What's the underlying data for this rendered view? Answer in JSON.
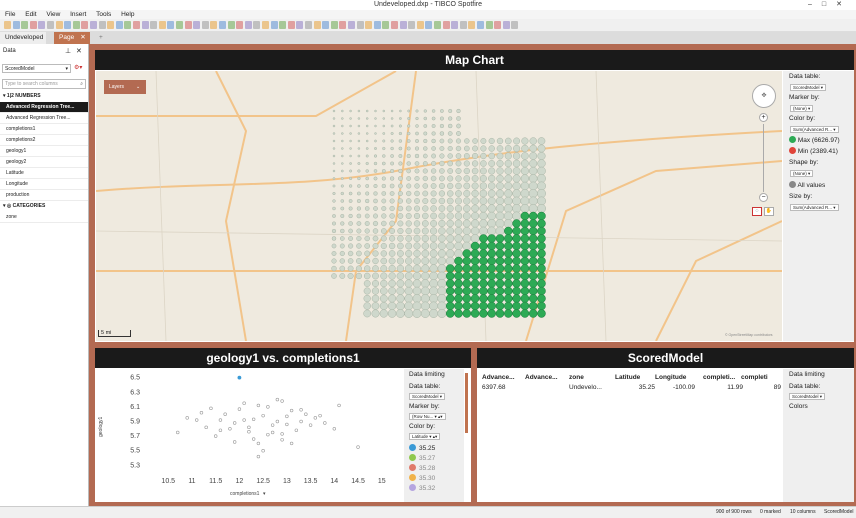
{
  "window": {
    "title": "Undeveloped.dxp - TIBCO Spotfire"
  },
  "menu": [
    "File",
    "Edit",
    "View",
    "Insert",
    "Tools",
    "Help"
  ],
  "tabs": {
    "first": "Undeveloped",
    "second": "Page"
  },
  "data_panel": {
    "title": "Data",
    "table": "ScoredModel",
    "search_placeholder": "Type to search columns",
    "numbers_header": "NUMBERS",
    "categories_header": "CATEGORIES",
    "columns": [
      "Advanced Regression Tree...",
      "Advanced Regression Tree...",
      "completions1",
      "completions2",
      "geology1",
      "geology2",
      "Latitude",
      "Longitude",
      "production"
    ],
    "categories": [
      "zone"
    ]
  },
  "map_chart": {
    "title": "Map Chart",
    "layers_button": "Layers",
    "scale": "5 mi",
    "attribution": "© OpenStreetMap contributors",
    "legend": {
      "data_table_label": "Data table:",
      "data_table": "ScoredModel",
      "marker_by_label": "Marker by:",
      "marker_by": "(None)",
      "color_by_label": "Color by:",
      "color_by": "Sum(Advanced R...",
      "max_label": "Max (6626.97)",
      "min_label": "Min (2389.41)",
      "shape_by_label": "Shape by:",
      "shape_by": "(None)",
      "all_values": "All values",
      "size_by_label": "Size by:",
      "size_by": "Sum(Advanced R...",
      "max_color": "#2daa55",
      "min_color": "#e0443a"
    }
  },
  "scatter": {
    "title": "geology1 vs. completions1",
    "legend": {
      "limiting": "Data limiting",
      "data_table_label": "Data table:",
      "data_table": "ScoredModel",
      "marker_by_label": "Marker by:",
      "marker_by": "(Row Nu...",
      "color_by_label": "Color by:",
      "color_by": "Latitude",
      "entries": [
        {
          "label": "35.25",
          "color": "#3a9ad6"
        },
        {
          "label": "35.27",
          "color": "#8fc84e"
        },
        {
          "label": "35.28",
          "color": "#e07a6a"
        },
        {
          "label": "35.30",
          "color": "#f0b24a"
        },
        {
          "label": "35.32",
          "color": "#b5a5e0"
        }
      ]
    }
  },
  "chart_data": [
    {
      "type": "scatter",
      "title": "geology1 vs. completions1",
      "xlabel": "completions1",
      "ylabel": "geology1",
      "xlim": [
        10.2,
        15.3
      ],
      "ylim": [
        5.25,
        6.55
      ],
      "x_ticks": [
        "10.5",
        "11",
        "11.5",
        "12",
        "12.5",
        "13",
        "13.5",
        "14",
        "14.5",
        "15"
      ],
      "y_ticks": [
        "6.5",
        "6.3",
        "6.1",
        "5.9",
        "5.7",
        "5.5",
        "5.3"
      ],
      "x": [
        12.0,
        11.2,
        11.6,
        12.4,
        12.9,
        13.1,
        13.6,
        12.2,
        11.9,
        12.7,
        13.3,
        12.5,
        11.4,
        14.1,
        10.7,
        12.8,
        13.0,
        12.3,
        12.6,
        11.8,
        13.4,
        12.1,
        12.9,
        11.5,
        13.8,
        12.4,
        12.0,
        13.2,
        11.1,
        12.6,
        14.5,
        10.9,
        12.3,
        13.5,
        11.7,
        12.8,
        12.2,
        13.1,
        11.3,
        12.5,
        13.7,
        12.9,
        11.9,
        12.1,
        14.0,
        12.7,
        13.3,
        11.6,
        12.4,
        13.0
      ],
      "y": [
        6.5,
        6.02,
        5.92,
        6.12,
        6.18,
        6.05,
        5.95,
        5.82,
        5.88,
        5.75,
        5.9,
        5.98,
        6.08,
        6.12,
        5.75,
        6.2,
        5.86,
        5.93,
        5.72,
        5.8,
        6.0,
        6.15,
        5.65,
        5.7,
        5.88,
        5.6,
        6.07,
        5.78,
        5.92,
        6.1,
        5.55,
        5.95,
        5.66,
        5.85,
        6.0,
        5.9,
        5.76,
        5.6,
        5.82,
        5.5,
        5.98,
        5.73,
        5.62,
        5.92,
        5.8,
        5.85,
        6.06,
        5.78,
        5.42,
        5.97
      ]
    }
  ],
  "table": {
    "title": "ScoredModel",
    "columns": [
      "Advance...",
      "Advance...",
      "zone",
      "Latitude",
      "Longitude",
      "completi...",
      "completi"
    ],
    "row": [
      "6397.68",
      "",
      "Undevelo...",
      "35.25",
      "-100.09",
      "11.99",
      "89"
    ],
    "legend": {
      "limiting": "Data limiting",
      "data_table_label": "Data table:",
      "data_table": "ScoredModel",
      "colors_label": "Colors"
    }
  },
  "status": {
    "rows": "900 of 900 rows",
    "marked": "0 marked",
    "columns": "10 columns",
    "table": "ScoredModel"
  }
}
